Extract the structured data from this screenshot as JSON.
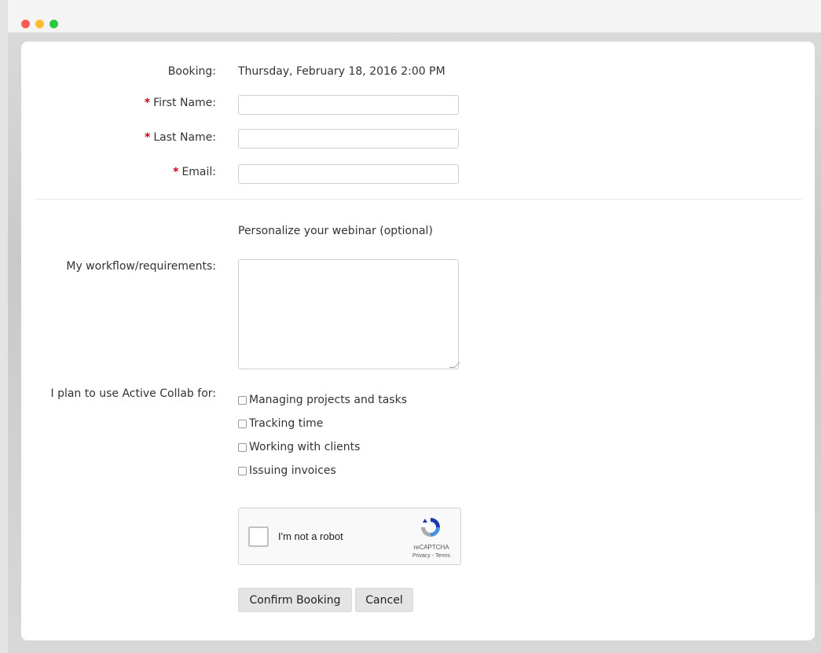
{
  "form": {
    "booking_label": "Booking:",
    "booking_value": "Thursday, February 18, 2016 2:00 PM",
    "required_marker": "*",
    "first_name_label": "First Name:",
    "first_name_value": "",
    "last_name_label": "Last Name:",
    "last_name_value": "",
    "email_label": "Email:",
    "email_value": "",
    "personalize_heading": "Personalize your webinar (optional)",
    "workflow_label": "My workflow/requirements:",
    "workflow_value": "",
    "plan_label": "I plan to use Active Collab for:",
    "plan_options": [
      {
        "label": "Managing projects and tasks",
        "checked": false
      },
      {
        "label": "Tracking time",
        "checked": false
      },
      {
        "label": "Working with clients",
        "checked": false
      },
      {
        "label": "Issuing invoices",
        "checked": false
      }
    ]
  },
  "recaptcha": {
    "label": "I'm not a robot",
    "brand": "reCAPTCHA",
    "terms": "Privacy - Terms",
    "logo_icon": "recaptcha-icon"
  },
  "actions": {
    "confirm_label": "Confirm Booking",
    "cancel_label": "Cancel"
  },
  "colors": {
    "required": "#d0021b",
    "button_bg": "#e4e4e4",
    "traffic_red": "#fb5c55",
    "traffic_yellow": "#fdbc2f",
    "traffic_green": "#2ac940"
  }
}
